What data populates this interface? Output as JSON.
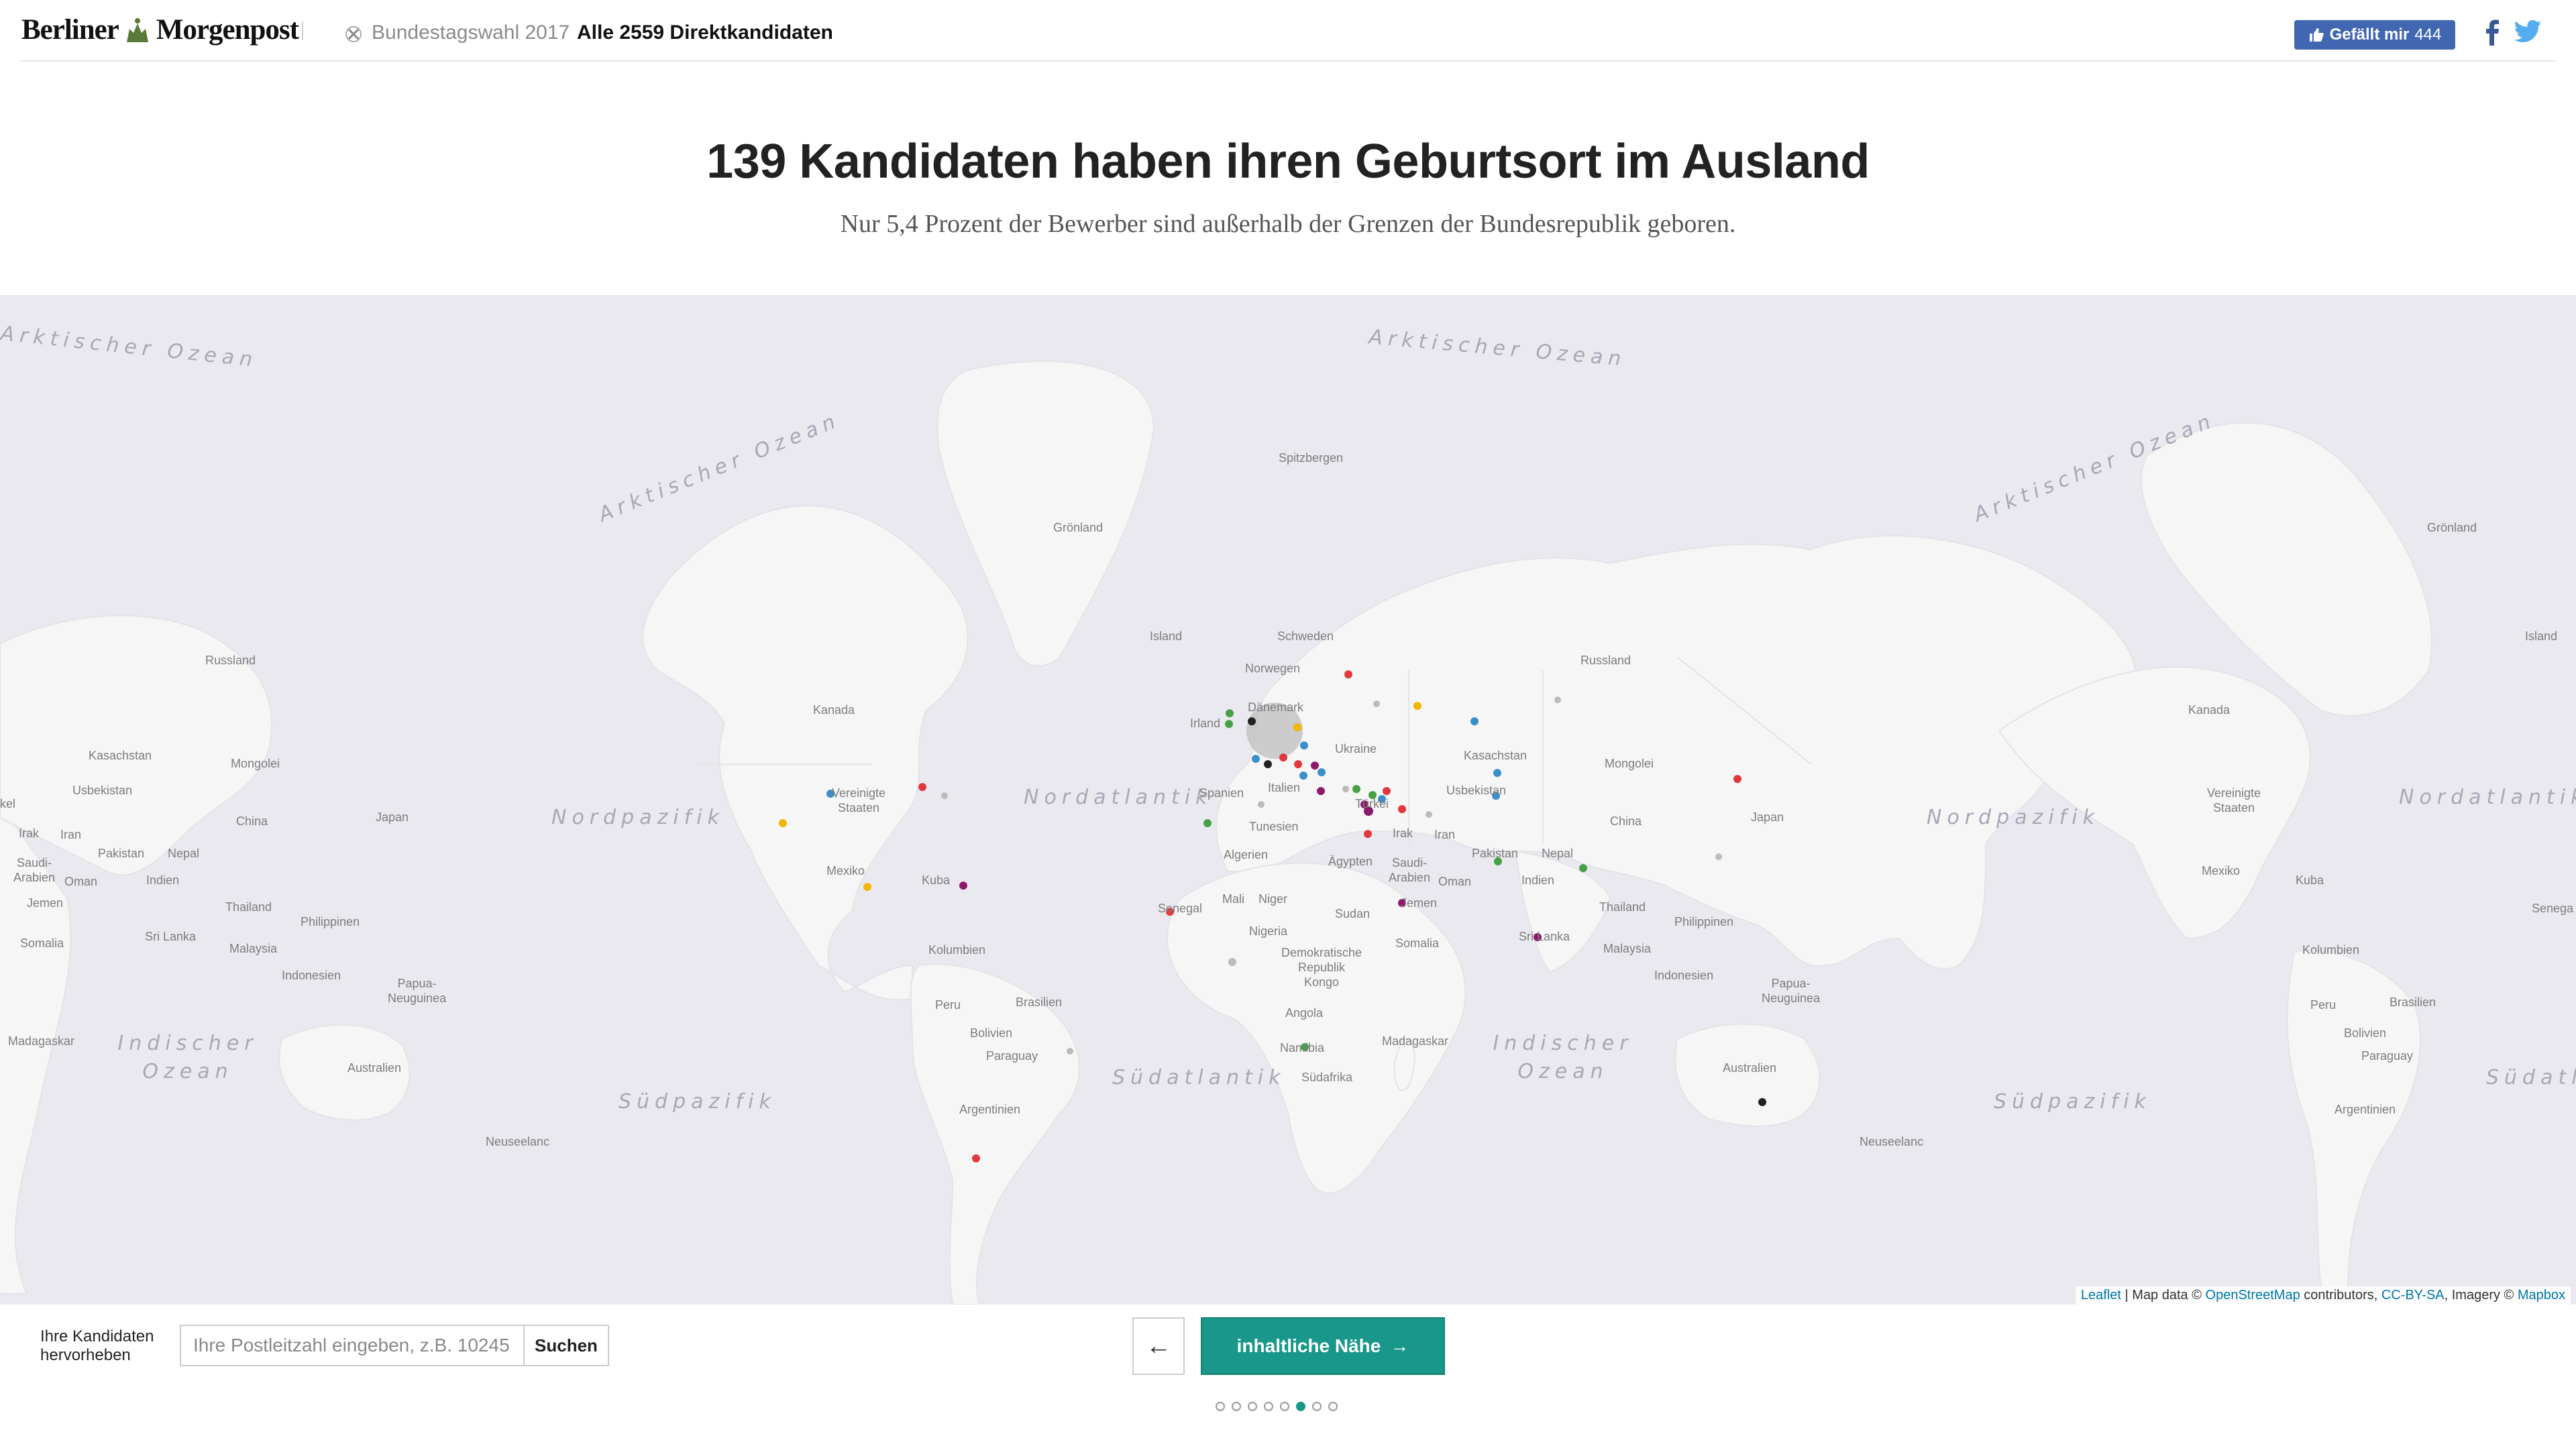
{
  "header": {
    "logo_text_left": "Berliner",
    "logo_text_right": "Morgenpost",
    "breadcrumb_parent": "Bundestagswahl 2017",
    "breadcrumb_current": "Alle 2559 Direktkandidaten",
    "fb_like_label": "Gefällt mir",
    "fb_like_count": "444",
    "fb_share_icon": "facebook-icon",
    "twitter_icon": "twitter-icon",
    "fb_color": "#4267b2"
  },
  "title": {
    "headline": "139 Kandidaten haben ihren Geburtsort im Ausland",
    "subline": "Nur 5,4 Prozent der Bewerber sind außerhalb der Grenzen der Bundesrepublik geboren."
  },
  "map": {
    "oceans": {
      "arctic1": "Arktischer Ozean",
      "arctic2": "Arktischer Ozean",
      "arctic3": "Arktischer Ozean",
      "arctic4": "Arktischer Ozean",
      "nordpazifik1": "Nordpazifik",
      "nordpazifik2": "Nordpazifik",
      "nordatlantik1": "Nordatlantik",
      "nordatlantik2": "Nordatlantik",
      "indisch1": "Indischer Ozean",
      "indisch2": "Indischer Ozean",
      "suedpazifik1": "Südpazifik",
      "suedpazifik2": "Südpazifik",
      "suedatlantik1": "Südatlantik",
      "suedatlantik2": "Südatla"
    },
    "places": {
      "spitzbergen": "Spitzbergen",
      "groenland1": "Grönland",
      "groenland2": "Grönland",
      "island1": "Island",
      "island2": "Island",
      "schweden": "Schweden",
      "norwegen": "Norwegen",
      "russland1": "Russland",
      "russland2": "Russland",
      "kanada1": "Kanada",
      "kanada2": "Kanada",
      "daenemark": "Dänemark",
      "irland": "Irland",
      "ukraine": "Ukraine",
      "kasachstan1": "Kasachstan",
      "kasachstan2": "Kasachstan",
      "mongolei1": "Mongolei",
      "mongolei2": "Mongolei",
      "usbekistan1": "Usbekistan",
      "usbekistan2": "Usbekistan",
      "kel": "kel",
      "china1": "China",
      "china2": "China",
      "japan1": "Japan",
      "japan2": "Japan",
      "irak1": "Irak",
      "iran1": "Iran",
      "irak2": "Irak",
      "iran2": "Iran",
      "pakistan1": "Pakistan",
      "nepal1": "Nepal",
      "pakistan2": "Pakistan",
      "nepal2": "Nepal",
      "saudi1": "Saudi-\nArabien",
      "saudi2": "Saudi-\nArabien",
      "oman1": "Oman",
      "oman2": "Oman",
      "indien1": "Indien",
      "indien2": "Indien",
      "jemen1": "Jemen",
      "jemen2": "Jemen",
      "thailand1": "Thailand",
      "thailand2": "Thailand",
      "philippinen1": "Philippinen",
      "philippinen2": "Philippinen",
      "somalia1": "Somalia",
      "somalia2": "Somalia",
      "srilanka1": "Sri Lanka",
      "srilanka2": "Sri Lanka",
      "malaysia1": "Malaysia",
      "malaysia2": "Malaysia",
      "indonesien1": "Indonesien",
      "indonesien2": "Indonesien",
      "papua1": "Papua-\nNeuguinea",
      "papua2": "Papua-\nNeuguinea",
      "madagaskar1": "Madagaskar",
      "madagaskar2": "Madagaskar",
      "australien1": "Australien",
      "australien2": "Australien",
      "neuseeland1": "Neuseelanc",
      "neuseeland2": "Neuseelanc",
      "usa1": "Vereinigte\nStaaten",
      "usa2": "Vereinigte\nStaaten",
      "mexiko1": "Mexiko",
      "mexiko2": "Mexiko",
      "kuba1": "Kuba",
      "kuba2": "Kuba",
      "kolumbien1": "Kolumbien",
      "kolumbien2": "Kolumbien",
      "peru1": "Peru",
      "peru2": "Peru",
      "brasilien1": "Brasilien",
      "brasilien2": "Brasilien",
      "bolivien1": "Bolivien",
      "bolivien2": "Bolivien",
      "paraguay1": "Paraguay",
      "paraguay2": "Paraguay",
      "argentinien1": "Argentinien",
      "argentinien2": "Argentinien",
      "spanien": "Spanien",
      "italien": "Italien",
      "tunesien": "Tunesien",
      "algerien": "Algerien",
      "aegypten": "Ägypten",
      "mali": "Mali",
      "niger": "Niger",
      "senegal1": "Senegal",
      "senegal2": "Senega",
      "sudan": "Sudan",
      "nigeria": "Nigeria",
      "kongo": "Demokratische\nRepublik\nKongo",
      "angola": "Angola",
      "namibia": "Namibia",
      "suedafrika": "Südafrika",
      "tuerkei": "Türkei"
    },
    "attribution": {
      "leaflet": "Leaflet",
      "sep": " | Map data © ",
      "osm": "OpenStreetMap",
      "contrib": " contributors, ",
      "license": "CC-BY-SA",
      "imagery": ", Imagery © ",
      "mapbox": "Mapbox"
    },
    "colors": {
      "water": "#eae9ef",
      "land": "#f6f6f6",
      "red": "#e0383e",
      "blue": "#3a8fc9",
      "green": "#45a146",
      "purple": "#8b1a6b",
      "yellow": "#f2b600",
      "black": "#222222",
      "grey": "#bbbbbb"
    }
  },
  "controls": {
    "highlight_label_line1": "Ihre Kandidaten",
    "highlight_label_line2": "hervorheben",
    "zip_placeholder": "Ihre Postleitzahl eingeben, z.B. 10245",
    "zip_button": "Suchen",
    "back_icon": "arrow-left-icon",
    "back_glyph": "←",
    "next_label": "inhaltliche Nähe",
    "next_glyph": "→",
    "accent": "#18978a",
    "pager_total": 8,
    "pager_active": 6
  }
}
